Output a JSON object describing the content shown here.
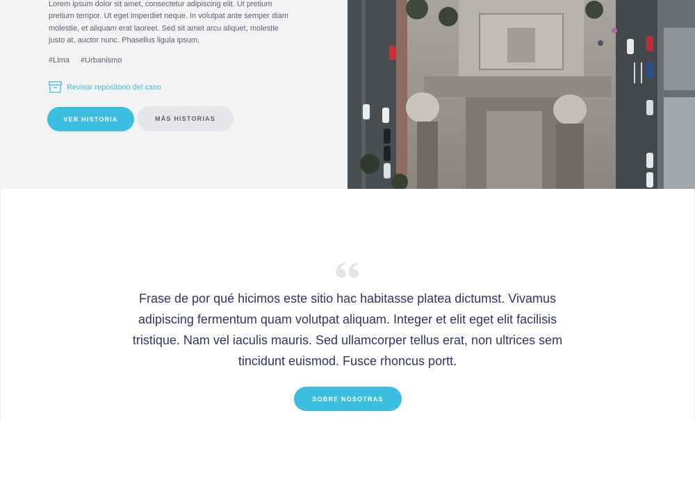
{
  "hero": {
    "paragraph": "Lorem ipsum dolor sit amet, consectetur adipiscing elit. Ut pretium pretium tempor. Ut eget imperdiet neque. In volutpat ante semper diam molestie, et aliquam erat laoreet. Sed sit amet arcu aliquet, molestie justo at, auctor nunc. Phasellus ligula ipsum,",
    "tags": [
      "#Lima",
      "#Urbanismo"
    ],
    "repo_link": "Revisar repositorio del caso",
    "primary_button": "VER HISTORIA",
    "secondary_button": "MÁS HISTORIAS"
  },
  "quote": {
    "text": "Frase de por qué hicimos este sitio hac habitasse platea dictumst. Vivamus adipiscing fermentum quam volutpat aliquam. Integer et elit eget elit facilisis tristique. Nam vel iaculis mauris. Sed ullamcorper tellus erat, non ultrices sem tincidunt euismod. Fusce rhoncus portt.",
    "button": "SOBRE NOSOTRAS"
  },
  "icons": {
    "repo": "archive-box-icon",
    "quote": "quote-mark-icon"
  },
  "colors": {
    "accent": "#3bbedf",
    "text_dark": "#2f3468",
    "text_body": "#5a5f75",
    "hero_bg": "#f3f3f3"
  }
}
